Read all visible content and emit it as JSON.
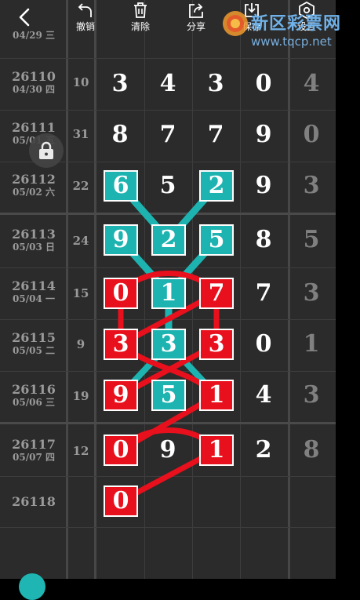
{
  "toolbar": {
    "undo_label": "撤销",
    "clear_label": "清除",
    "share_label": "分享",
    "save_label": "保存",
    "settings_label": "设置"
  },
  "watermark": {
    "name": "新区彩票网",
    "url": "www.tqcp.net"
  },
  "rows": [
    {
      "issue": "",
      "date": "04/29 三",
      "span": "",
      "digits": []
    },
    {
      "issue": "26110",
      "date": "04/30 四",
      "span": "10",
      "digits": [
        "3",
        "4",
        "3",
        "0",
        "4"
      ]
    },
    {
      "issue": "26111",
      "date": "05/01 五",
      "span": "31",
      "digits": [
        "8",
        "7",
        "7",
        "9",
        "0"
      ]
    },
    {
      "issue": "26112",
      "date": "05/02 六",
      "span": "22",
      "digits": [
        "6",
        "5",
        "2",
        "9",
        "3"
      ]
    },
    {
      "issue": "26113",
      "date": "05/03 日",
      "span": "24",
      "digits": [
        "9",
        "2",
        "5",
        "8",
        "5"
      ]
    },
    {
      "issue": "26114",
      "date": "05/04 一",
      "span": "15",
      "digits": [
        "0",
        "1",
        "7",
        "7",
        "3"
      ]
    },
    {
      "issue": "26115",
      "date": "05/05 二",
      "span": "9",
      "digits": [
        "3",
        "3",
        "3",
        "0",
        "1"
      ]
    },
    {
      "issue": "26116",
      "date": "05/06 三",
      "span": "19",
      "digits": [
        "9",
        "5",
        "1",
        "4",
        "3"
      ]
    },
    {
      "issue": "26117",
      "date": "05/07 四",
      "span": "12",
      "digits": [
        "0",
        "9",
        "1",
        "2",
        "8"
      ]
    },
    {
      "issue": "26118",
      "date": "",
      "span": "",
      "digits": [
        "0"
      ]
    }
  ],
  "colors": {
    "red": "#e8101c",
    "teal": "#1db3b0",
    "grid_bg": "#2b2b2b"
  }
}
